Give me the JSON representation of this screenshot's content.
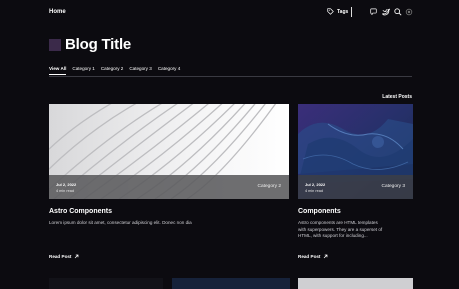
{
  "nav": {
    "home": "Home",
    "tags": "Tags"
  },
  "blog": {
    "title": "Blog Title"
  },
  "categories": [
    "View All",
    "Category 1",
    "Category 2",
    "Category 3",
    "Category 4"
  ],
  "section": {
    "latest": "Latest Posts"
  },
  "posts": [
    {
      "date": "Jul 2, 2022",
      "read": "4 min read",
      "category": "Category 2",
      "title": "Astro Components",
      "description": "Lorem ipsum dolor sit amet, consectetur adipiscing elit. Donec non dia",
      "cta": "Read Post"
    },
    {
      "date": "Jul 2, 2022",
      "read": "4 min read",
      "category": "Category 3",
      "title": "Components",
      "description_lines": [
        "Astro components are HTML templates",
        "with superpowers. They are a superset of",
        "HTML, with support for including..."
      ],
      "cta": "Read Post"
    }
  ],
  "colors": {
    "background": "#0c0b10",
    "accent_square": "#3b2a4a",
    "divider": "#3a3a42"
  }
}
